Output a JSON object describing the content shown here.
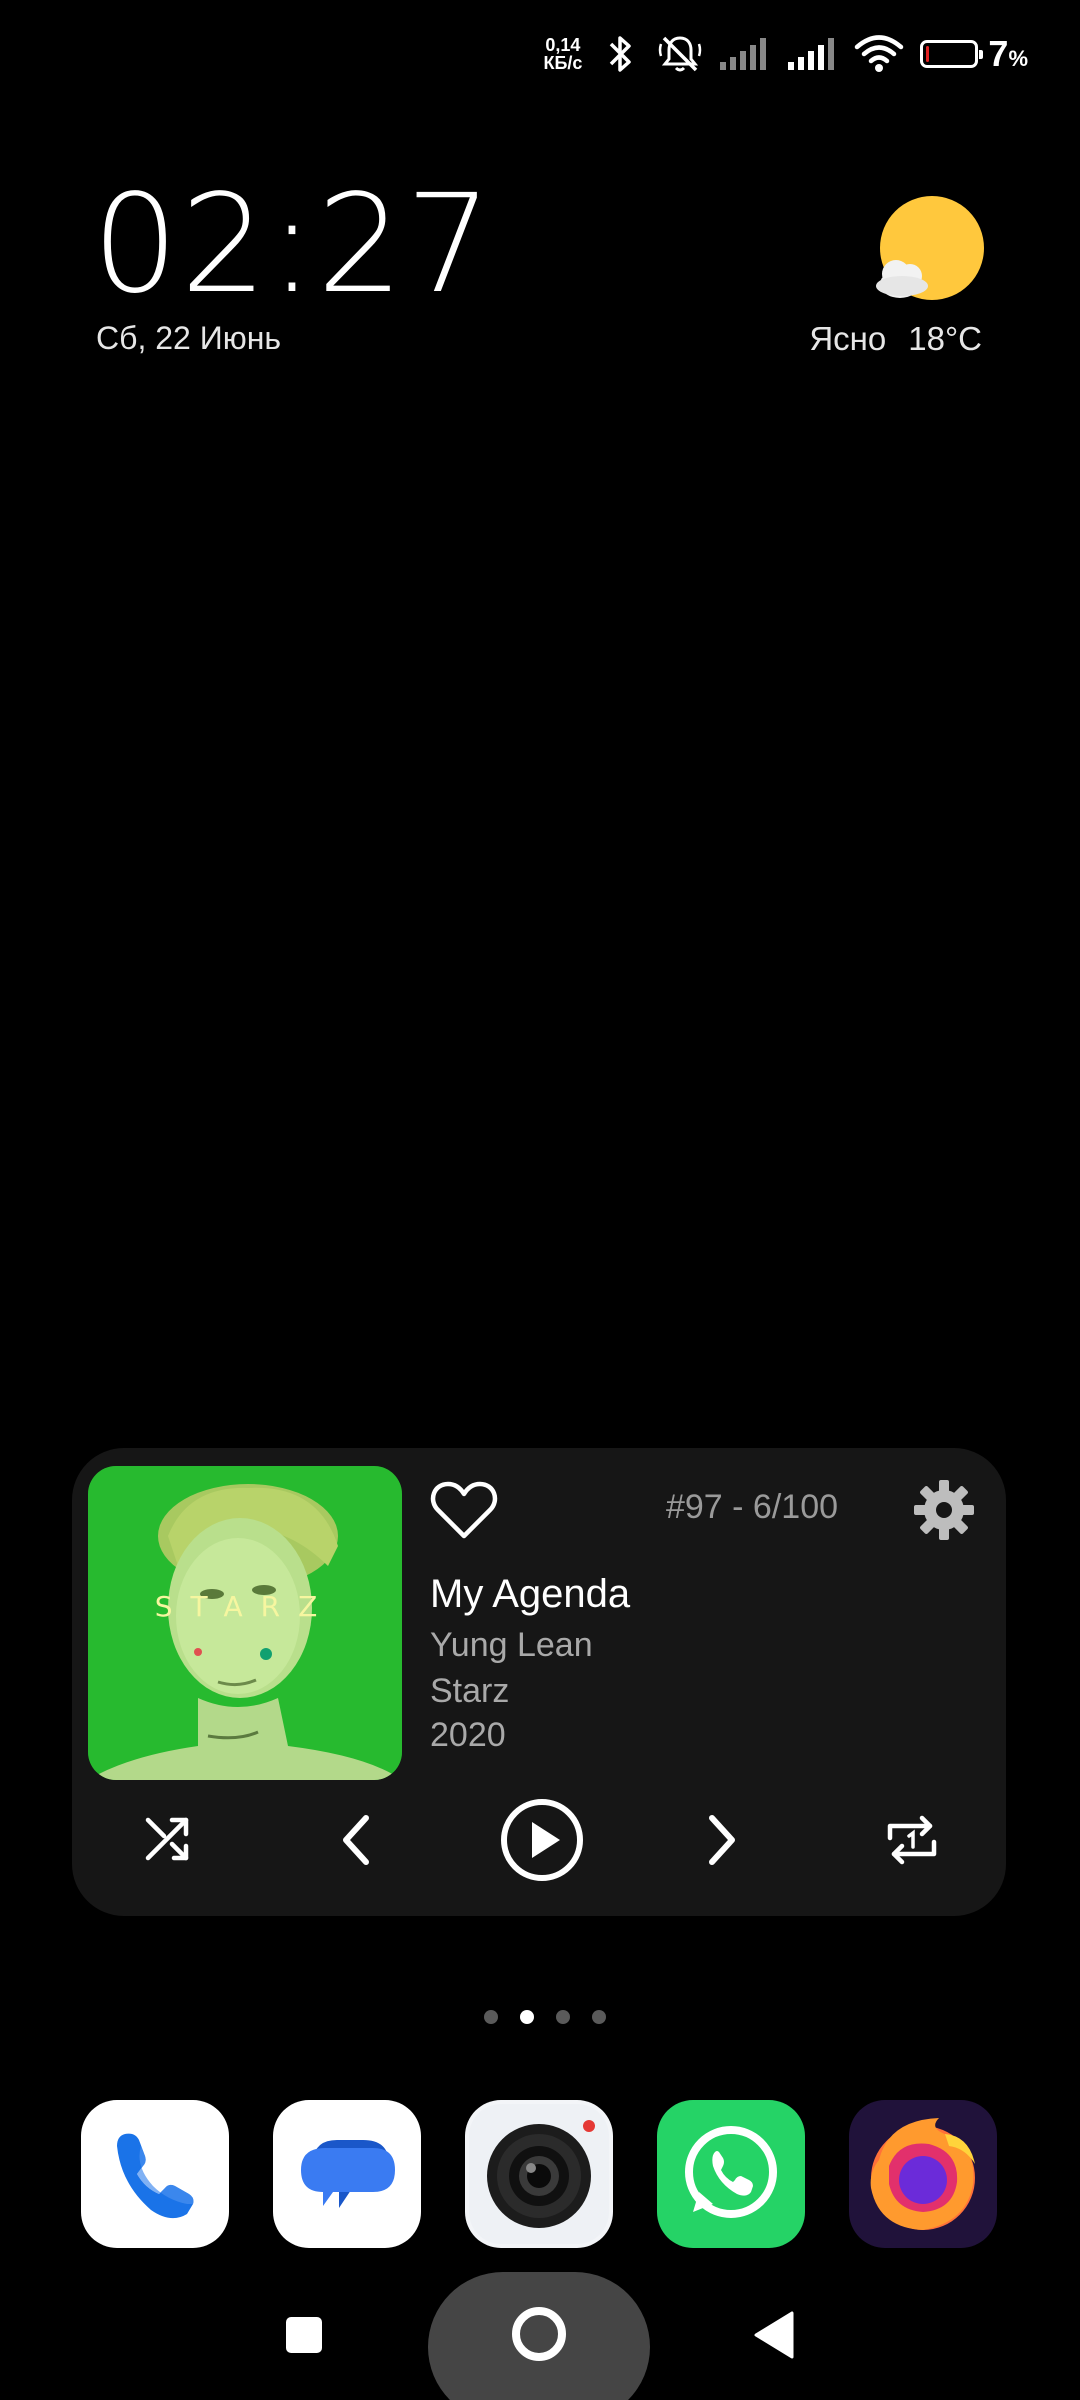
{
  "status_bar": {
    "net_speed_value": "0,14",
    "net_speed_unit": "КБ/с",
    "icons": [
      "bluetooth-icon",
      "silent-mode-icon",
      "signal-sim1-icon",
      "signal-sim2-icon",
      "wifi-icon",
      "battery-icon"
    ],
    "battery_level": 0.07,
    "battery_value": "7",
    "battery_unit": "%",
    "battery_color": "#e02020"
  },
  "clock_widget": {
    "time": "02:27",
    "date": "Сб, 22 Июнь"
  },
  "weather_widget": {
    "condition": "Ясно",
    "temperature": "18°C",
    "icon": "sun-cloud-icon"
  },
  "music_widget": {
    "track_counter": "#97 - 6/100",
    "title": "My Agenda",
    "artist": "Yung Lean",
    "album": "Starz",
    "year": "2020",
    "album_art_text": "STARZ",
    "controls": [
      "shuffle-icon",
      "previous-icon",
      "play-icon",
      "next-icon",
      "repeat-one-icon"
    ]
  },
  "home_pages": {
    "count": 4,
    "active_index": 1
  },
  "dock": {
    "apps": [
      "phone",
      "messages",
      "camera",
      "whatsapp",
      "firefox"
    ]
  },
  "colors": {
    "background": "#000000",
    "widget_bg": "#161616",
    "sun": "#FFC83D",
    "whatsapp_green": "#25D366",
    "album_green": "#22b52a"
  }
}
